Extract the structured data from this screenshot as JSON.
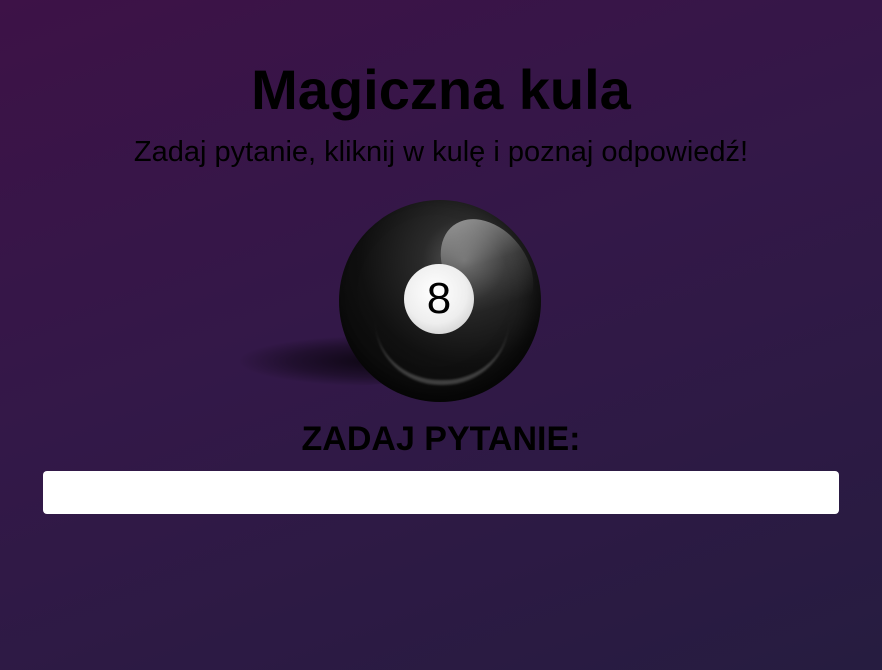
{
  "header": {
    "title": "Magiczna kula",
    "subtitle": "Zadaj pytanie, kliknij w kulę i poznaj odpowiedź!"
  },
  "ball": {
    "number": "8",
    "icon": "magic-8-ball"
  },
  "question": {
    "label": "ZADAJ PYTANIE:",
    "value": "",
    "placeholder": ""
  },
  "colors": {
    "background_start": "#3d1247",
    "background_end": "#261c40",
    "text": "#000000",
    "input_background": "#ffffff"
  }
}
